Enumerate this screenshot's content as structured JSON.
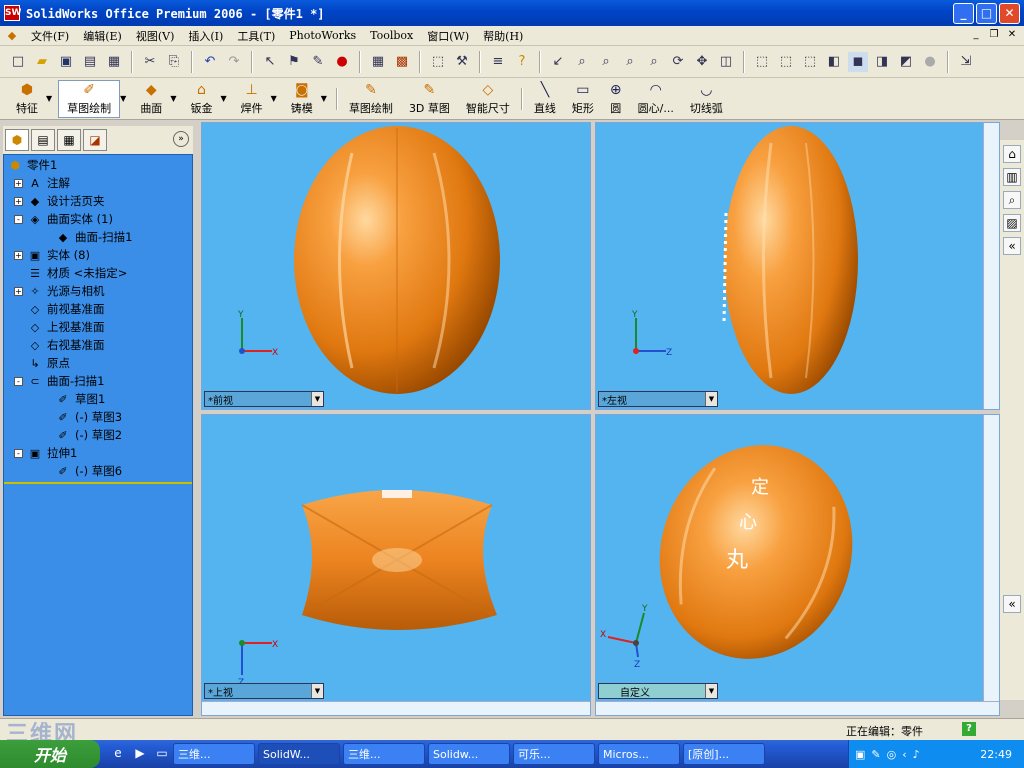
{
  "window": {
    "title": "SolidWorks Office Premium 2006 - [零件1 *]",
    "app_icon": "SW"
  },
  "menu": [
    "文件(F)",
    "编辑(E)",
    "视图(V)",
    "插入(I)",
    "工具(T)",
    "PhotoWorks",
    "Toolbox",
    "窗口(W)",
    "帮助(H)"
  ],
  "command_manager": {
    "tabs": [
      "特征",
      "草图绘制",
      "曲面",
      "钣金",
      "焊件",
      "铸模"
    ],
    "sketch_tools": [
      "草图绘制",
      "3D 草图",
      "智能尺寸",
      "直线",
      "矩形",
      "圆",
      "圆心/...",
      "切线弧"
    ]
  },
  "feature_tree": {
    "root": "零件1",
    "nodes": [
      {
        "label": "注解",
        "expander": "+",
        "icon": "annotations-icon",
        "indent": 0
      },
      {
        "label": "设计活页夹",
        "expander": "+",
        "icon": "design-binder-icon",
        "indent": 0
      },
      {
        "label": "曲面实体 (1)",
        "expander": "-",
        "icon": "surface-bodies-icon",
        "indent": 0
      },
      {
        "label": "曲面-扫描1",
        "expander": "",
        "icon": "surface-icon",
        "indent": 1
      },
      {
        "label": "实体 (8)",
        "expander": "+",
        "icon": "solid-bodies-icon",
        "indent": 0
      },
      {
        "label": "材质 <未指定>",
        "expander": "",
        "icon": "material-icon",
        "indent": 0
      },
      {
        "label": "光源与相机",
        "expander": "+",
        "icon": "lights-icon",
        "indent": 0
      },
      {
        "label": "前视基准面",
        "expander": "",
        "icon": "plane-icon",
        "indent": 0
      },
      {
        "label": "上视基准面",
        "expander": "",
        "icon": "plane-icon",
        "indent": 0
      },
      {
        "label": "右视基准面",
        "expander": "",
        "icon": "plane-icon",
        "indent": 0
      },
      {
        "label": "原点",
        "expander": "",
        "icon": "origin-icon",
        "indent": 0
      },
      {
        "label": "曲面-扫描1",
        "expander": "-",
        "icon": "sweep-icon",
        "indent": 0
      },
      {
        "label": "草图1",
        "expander": "",
        "icon": "sketch-icon",
        "indent": 1
      },
      {
        "label": "(-) 草图3",
        "expander": "",
        "icon": "sketch-icon",
        "indent": 1
      },
      {
        "label": "(-) 草图2",
        "expander": "",
        "icon": "sketch-icon",
        "indent": 1
      },
      {
        "label": "拉伸1",
        "expander": "-",
        "icon": "extrude-icon",
        "indent": 0
      },
      {
        "label": "(-) 草图6",
        "expander": "",
        "icon": "sketch-icon",
        "indent": 1
      }
    ]
  },
  "viewports": [
    {
      "label": "*前视",
      "axes": [
        "Y",
        "X"
      ]
    },
    {
      "label": "*左视",
      "axes": [
        "Y",
        "Z"
      ]
    },
    {
      "label": "*上视",
      "axes": [
        "X",
        "Z"
      ]
    },
    {
      "label": "自定义",
      "axes": [
        "Y",
        "X",
        "Z"
      ]
    }
  ],
  "engraving": [
    "定",
    "心",
    "丸"
  ],
  "status": {
    "text": "正在编辑：零件",
    "help": "?"
  },
  "watermark": "三维网",
  "taskbar": {
    "start": "开始",
    "tasks": [
      "三维...",
      "SolidW...",
      "三维...",
      "Solidw...",
      "可乐...",
      "Micros...",
      "[原创]..."
    ],
    "clock": "22:49"
  },
  "colors": {
    "viewport_bg": "#53b4f0",
    "model": "#f08a1e",
    "tree_bg": "#3b8ee8"
  }
}
